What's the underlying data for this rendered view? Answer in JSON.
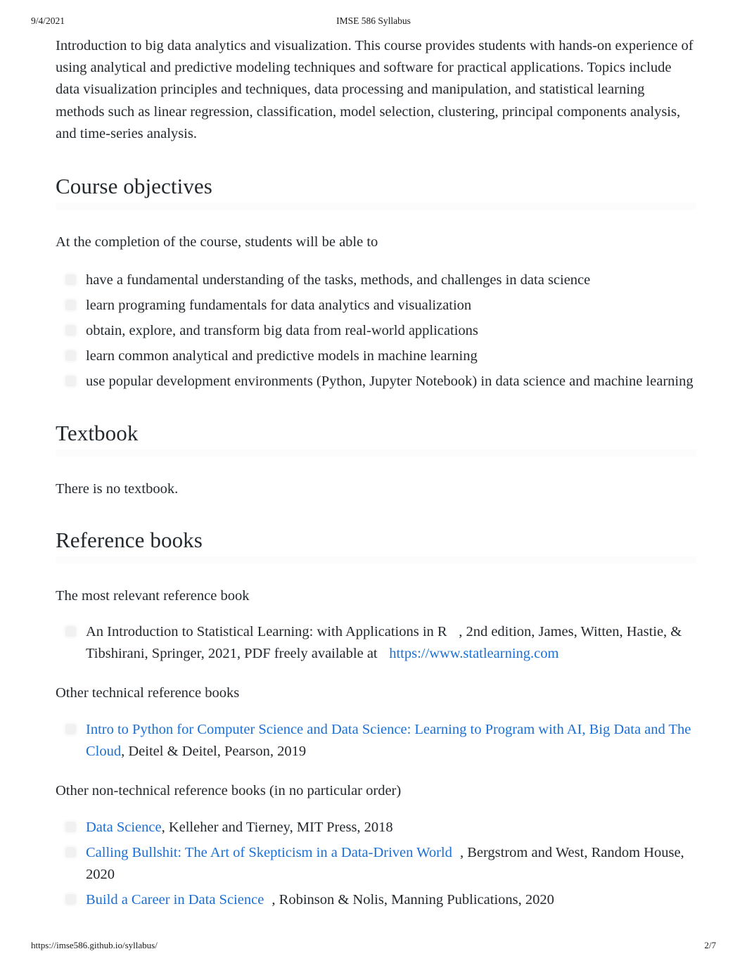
{
  "print_header": {
    "date": "9/4/2021",
    "title": "IMSE 586 Syllabus"
  },
  "print_footer": {
    "url": "https://imse586.github.io/syllabus/",
    "page": "2/7"
  },
  "intro": {
    "paragraph": "Introduction to big data analytics and visualization. This course provides students with hands-on experience of using analytical and predictive modeling techniques and software for practical applications. Topics include data visualization principles and techniques, data processing and manipulation, and statistical learning methods such as linear regression, classification, model selection, clustering, principal components analysis, and time-series analysis."
  },
  "sections": {
    "course_objectives": {
      "heading": "Course objectives",
      "lead": "At the completion of the course, students will be able to",
      "items": [
        "have a fundamental understanding of the tasks, methods, and challenges in data science",
        "learn programing fundamentals for data analytics and visualization",
        "obtain, explore, and transform big data from real-world applications",
        "learn common analytical and predictive models in machine learning",
        "use popular development environments (Python, Jupyter Notebook) in data science and machine learning"
      ]
    },
    "textbook": {
      "heading": "Textbook",
      "body": "There is no textbook."
    },
    "reference_books": {
      "heading": "Reference books",
      "lead_most_relevant": "The most relevant reference book",
      "most_relevant_item": {
        "title": "An Introduction to Statistical Learning: with Applications in R",
        "detail": ", 2nd edition, James, Witten, Hastie, & Tibshirani, Springer, 2021, PDF freely available at",
        "link_text": "https://www.statlearning.com"
      },
      "lead_technical": "Other  technical  reference books",
      "technical_items": [
        {
          "link_text": "Intro to Python for Computer Science and Data Science: Learning to Program with AI, Big Data and The Cloud",
          "detail": ", Deitel & Deitel, Pearson, 2019"
        }
      ],
      "lead_non_technical": "Other  non-technical   reference books (in no particular order)",
      "non_technical_items": [
        {
          "link_text": "Data Science",
          "detail": ", Kelleher and Tierney, MIT Press, 2018"
        },
        {
          "link_text": "Calling Bullshit: The Art of Skepticism in a Data-Driven World",
          "detail": ", Bergstrom and West, Random House, 2020"
        },
        {
          "link_text": "Build a Career in Data Science",
          "detail": ", Robinson & Nolis, Manning Publications, 2020"
        }
      ]
    }
  },
  "colors": {
    "link": "#1a6fd4",
    "text": "#24292e",
    "rule": "#fcfcfd",
    "bullet": "#f1f1f1"
  },
  "icons": {
    "bullet": "list-bullet-icon"
  }
}
